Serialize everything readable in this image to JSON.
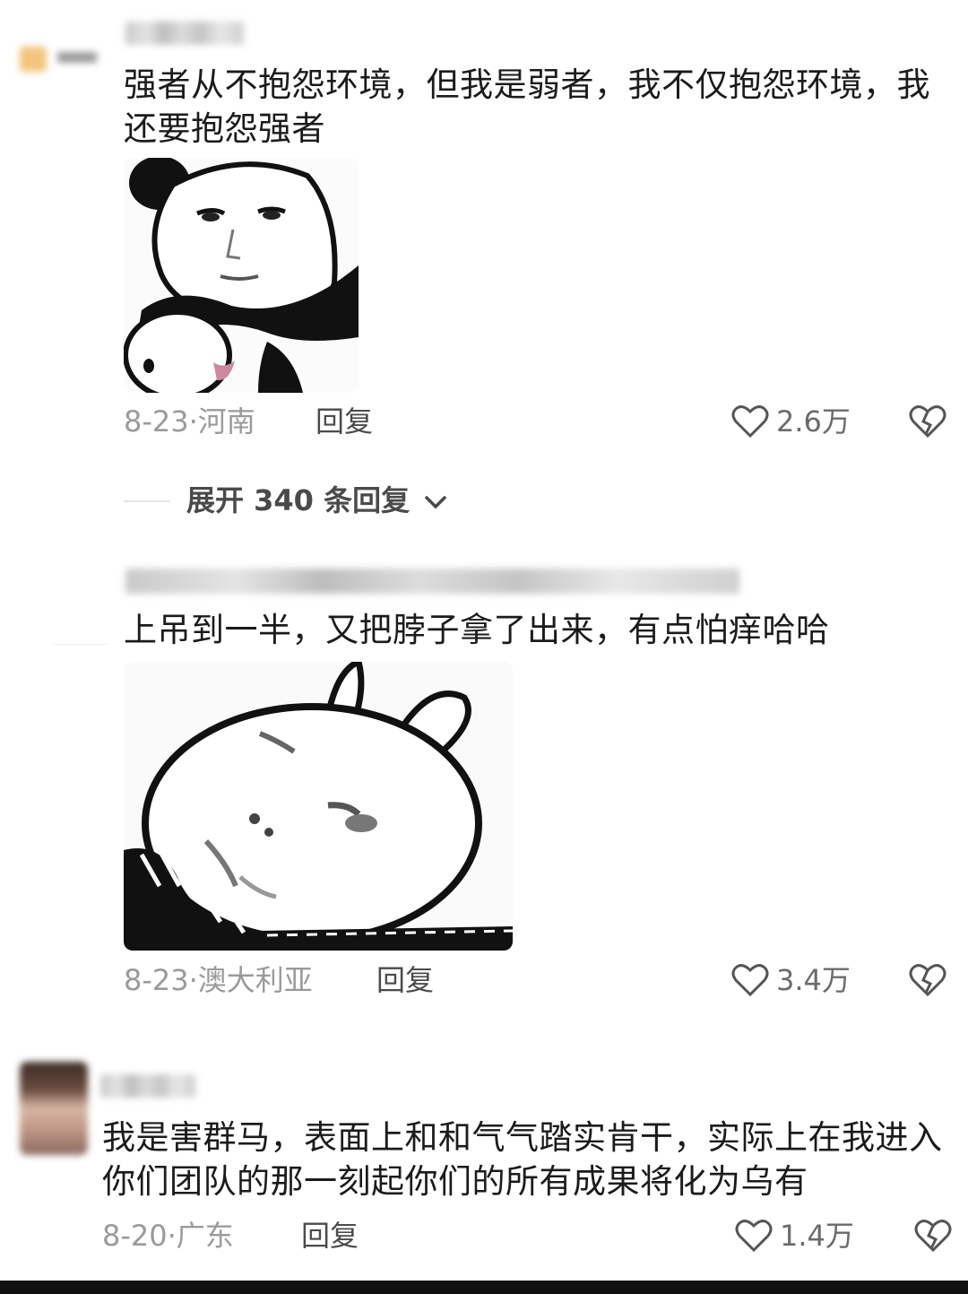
{
  "comments": [
    {
      "text": "强者从不抱怨环境，但我是弱者，我不仅抱怨环境，我还要抱怨强者",
      "sticker": "panda-face-meme-icon",
      "date": "8-23",
      "location": "河南",
      "reply_label": "回复",
      "likes": "2.6万"
    },
    {
      "text": "上吊到一半，又把脖子拿了出来，有点怕痒哈哈",
      "sticker": "rabbit-noose-meme-icon",
      "date": "8-23",
      "location": "澳大利亚",
      "reply_label": "回复",
      "likes": "3.4万"
    },
    {
      "text": "我是害群马，表面上和和气气踏实肯干，实际上在我进入你们团队的那一刻起你们的所有成果将化为乌有",
      "date": "8-20",
      "location": "广东",
      "reply_label": "回复",
      "likes": "1.4万"
    }
  ],
  "expand_replies": {
    "label": "展开 340 条回复"
  },
  "icons": {
    "like": "heart-outline-icon",
    "dislike": "broken-heart-icon",
    "expand": "chevron-down-icon"
  },
  "colors": {
    "text": "#1b1b1b",
    "meta": "#9a9a9a",
    "reply": "#4b4b4b"
  }
}
